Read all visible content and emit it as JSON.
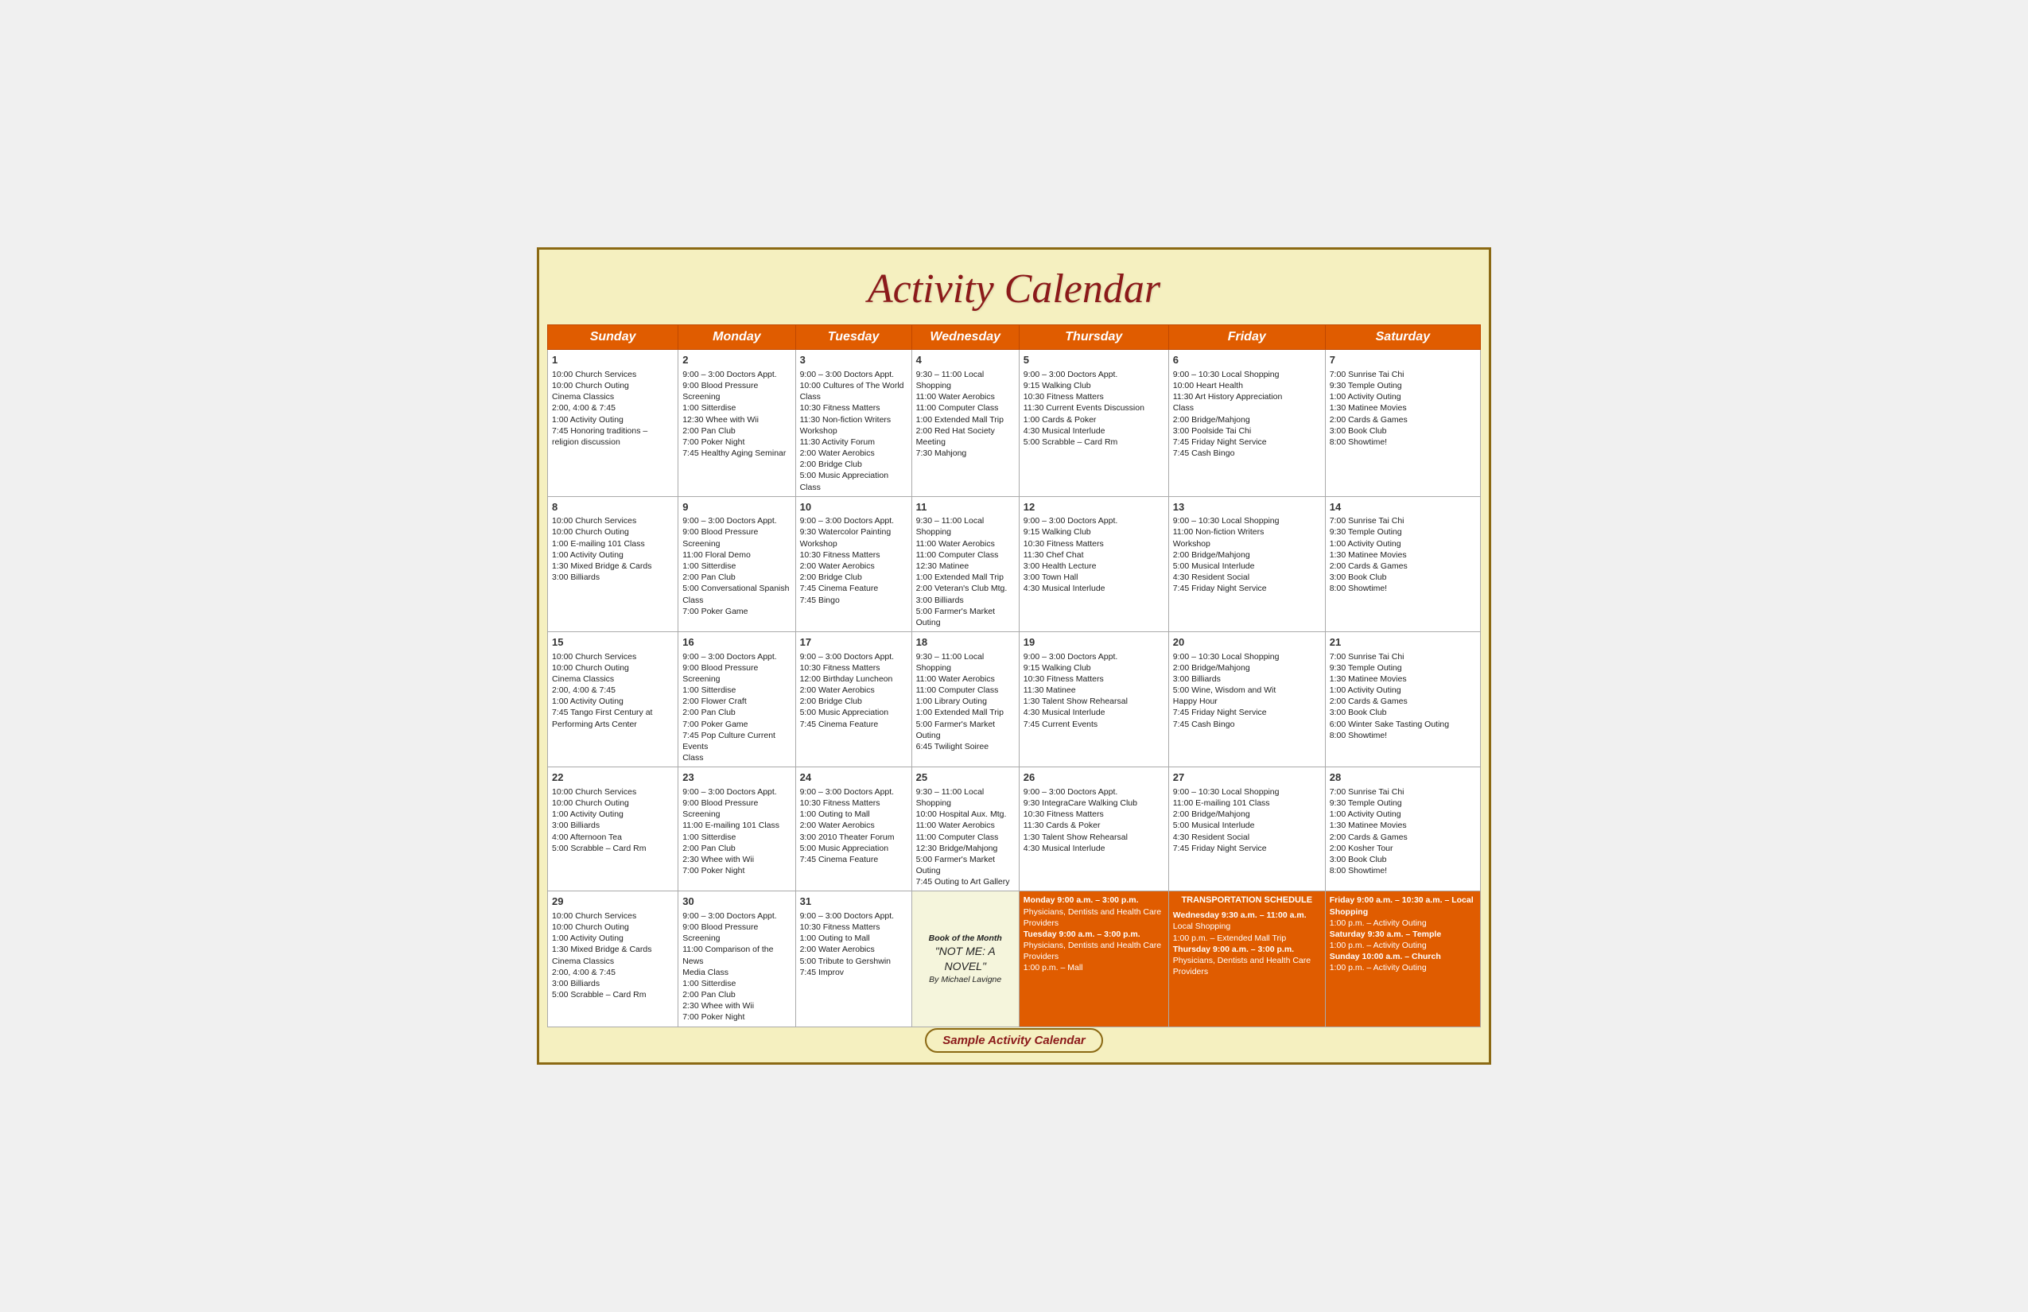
{
  "title": "Activity Calendar",
  "footer": "Sample Activity Calendar",
  "days": [
    "Sunday",
    "Monday",
    "Tuesday",
    "Wednesday",
    "Thursday",
    "Friday",
    "Saturday"
  ],
  "weeks": [
    {
      "cells": [
        {
          "day": 1,
          "events": [
            "10:00 Church Services",
            "10:00 Church Outing",
            "Cinema Classics",
            "2:00, 4:00 & 7:45",
            "1:00 Activity Outing",
            "7:45 Honoring traditions –",
            "religion discussion"
          ]
        },
        {
          "day": 2,
          "events": [
            "9:00 – 3:00 Doctors Appt.",
            "9:00 Blood Pressure Screening",
            "1:00 Sitterdise",
            "12:30 Whee with Wii",
            "2:00 Pan Club",
            "7:00 Poker Night",
            "7:45 Healthy Aging Seminar"
          ]
        },
        {
          "day": 3,
          "events": [
            "9:00 – 3:00 Doctors Appt.",
            "10:00 Cultures of The World Class",
            "10:30 Fitness Matters",
            "11:30 Non-fiction Writers Workshop",
            "11:30 Activity Forum",
            "2:00 Water Aerobics",
            "2:00 Bridge Club",
            "5:00 Music Appreciation Class"
          ]
        },
        {
          "day": 4,
          "events": [
            "9:30 – 11:00 Local Shopping",
            "11:00 Water Aerobics",
            "11:00 Computer Class",
            "1:00 Extended Mall Trip",
            "2:00 Red Hat Society Meeting",
            "7:30 Mahjong"
          ]
        },
        {
          "day": 5,
          "events": [
            "9:00 – 3:00 Doctors Appt.",
            "9:15 Walking Club",
            "10:30 Fitness Matters",
            "11:30 Current Events Discussion",
            "1:00 Cards & Poker",
            "4:30 Musical Interlude",
            "5:00 Scrabble – Card Rm"
          ]
        },
        {
          "day": 6,
          "events": [
            "9:00 – 10:30 Local Shopping",
            "10:00 Heart Health",
            "11:30 Art History Appreciation",
            "Class",
            "2:00 Bridge/Mahjong",
            "3:00 Poolside Tai Chi",
            "7:45 Friday Night Service",
            "7:45 Cash Bingo"
          ]
        },
        {
          "day": 7,
          "events": [
            "7:00 Sunrise Tai Chi",
            "9:30 Temple Outing",
            "1:00 Activity Outing",
            "1:30 Matinee Movies",
            "2:00 Cards & Games",
            "3:00 Book Club",
            "8:00 Showtime!"
          ]
        }
      ]
    },
    {
      "cells": [
        {
          "day": 8,
          "events": [
            "10:00 Church Services",
            "10:00 Church Outing",
            "1:00 E-mailing 101 Class",
            "1:00 Activity Outing",
            "1:30 Mixed Bridge & Cards",
            "3:00 Billiards"
          ]
        },
        {
          "day": 9,
          "events": [
            "9:00 – 3:00 Doctors Appt.",
            "9:00 Blood Pressure Screening",
            "11:00 Floral Demo",
            "1:00 Sitterdise",
            "2:00 Pan Club",
            "5:00 Conversational Spanish Class",
            "7:00 Poker Game"
          ]
        },
        {
          "day": 10,
          "events": [
            "9:00 – 3:00 Doctors Appt.",
            "9:30 Watercolor Painting",
            "Workshop",
            "10:30 Fitness Matters",
            "2:00 Water Aerobics",
            "2:00 Bridge Club",
            "7:45 Cinema Feature",
            "7:45 Bingo"
          ]
        },
        {
          "day": 11,
          "events": [
            "9:30 – 11:00 Local Shopping",
            "11:00 Water Aerobics",
            "11:00 Computer Class",
            "12:30 Matinee",
            "1:00 Extended Mall Trip",
            "2:00 Veteran's Club Mtg.",
            "3:00 Billiards",
            "5:00 Farmer's Market Outing"
          ]
        },
        {
          "day": 12,
          "events": [
            "9:00 – 3:00 Doctors Appt.",
            "9:15 Walking Club",
            "10:30 Fitness Matters",
            "11:30 Chef Chat",
            "3:00 Health Lecture",
            "3:00 Town Hall",
            "4:30 Musical Interlude"
          ]
        },
        {
          "day": 13,
          "events": [
            "9:00 – 10:30 Local Shopping",
            "11:00 Non-fiction Writers",
            "Workshop",
            "2:00 Bridge/Mahjong",
            "5:00 Musical Interlude",
            "4:30 Resident Social",
            "7:45 Friday Night Service"
          ]
        },
        {
          "day": 14,
          "events": [
            "7:00 Sunrise Tai Chi",
            "9:30 Temple Outing",
            "1:00 Activity Outing",
            "1:30 Matinee Movies",
            "2:00 Cards & Games",
            "3:00 Book Club",
            "8:00 Showtime!"
          ]
        }
      ]
    },
    {
      "cells": [
        {
          "day": 15,
          "events": [
            "10:00 Church Services",
            "10:00 Church Outing",
            "Cinema Classics",
            "2:00, 4:00 & 7:45",
            "1:00 Activity Outing",
            "7:45 Tango First Century at",
            "Performing Arts Center"
          ]
        },
        {
          "day": 16,
          "events": [
            "9:00 – 3:00 Doctors Appt.",
            "9:00 Blood Pressure Screening",
            "1:00 Sitterdise",
            "2:00 Flower Craft",
            "2:00 Pan Club",
            "7:00 Poker Game",
            "7:45 Pop Culture Current Events",
            "Class"
          ]
        },
        {
          "day": 17,
          "events": [
            "9:00 – 3:00 Doctors Appt.",
            "10:30 Fitness Matters",
            "12:00 Birthday Luncheon",
            "2:00 Water Aerobics",
            "2:00 Bridge Club",
            "5:00 Music Appreciation",
            "7:45 Cinema Feature"
          ]
        },
        {
          "day": 18,
          "events": [
            "9:30 – 11:00 Local Shopping",
            "11:00 Water Aerobics",
            "11:00 Computer Class",
            "1:00 Library Outing",
            "1:00 Extended Mall Trip",
            "5:00 Farmer's Market Outing",
            "6:45 Twilight Soiree"
          ]
        },
        {
          "day": 19,
          "events": [
            "9:00 – 3:00 Doctors Appt.",
            "9:15 Walking Club",
            "10:30 Fitness Matters",
            "11:30 Matinee",
            "1:30 Talent Show Rehearsal",
            "4:30 Musical Interlude",
            "7:45 Current Events"
          ]
        },
        {
          "day": 20,
          "events": [
            "9:00 – 10:30 Local Shopping",
            "2:00 Bridge/Mahjong",
            "3:00 Billiards",
            "5:00 Wine, Wisdom and Wit",
            "Happy Hour",
            "7:45 Friday Night Service",
            "7:45 Cash Bingo"
          ]
        },
        {
          "day": 21,
          "events": [
            "7:00 Sunrise Tai Chi",
            "9:30 Temple Outing",
            "1:30 Matinee Movies",
            "1:00 Activity Outing",
            "2:00 Cards & Games",
            "3:00 Book Club",
            "6:00 Winter Sake Tasting Outing",
            "8:00 Showtime!"
          ]
        }
      ]
    },
    {
      "cells": [
        {
          "day": 22,
          "events": [
            "10:00 Church Services",
            "10:00 Church Outing",
            "1:00 Activity Outing",
            "3:00 Billiards",
            "4:00 Afternoon Tea",
            "5:00 Scrabble – Card Rm"
          ]
        },
        {
          "day": 23,
          "events": [
            "9:00 – 3:00 Doctors Appt.",
            "9:00 Blood Pressure Screening",
            "11:00 E-mailing 101 Class",
            "1:00 Sitterdise",
            "2:00 Pan Club",
            "2:30 Whee with Wii",
            "7:00 Poker Night"
          ]
        },
        {
          "day": 24,
          "events": [
            "9:00 – 3:00 Doctors Appt.",
            "10:30 Fitness Matters",
            "1:00 Outing to Mall",
            "2:00 Water Aerobics",
            "3:00 2010 Theater Forum",
            "5:00 Music Appreciation",
            "7:45 Cinema Feature"
          ]
        },
        {
          "day": 25,
          "events": [
            "9:30 – 11:00 Local Shopping",
            "10:00 Hospital Aux. Mtg.",
            "11:00 Water Aerobics",
            "11:00 Computer Class",
            "12:30 Bridge/Mahjong",
            "5:00 Farmer's Market Outing",
            "7:45 Outing to Art Gallery"
          ]
        },
        {
          "day": 26,
          "events": [
            "9:00 – 3:00 Doctors Appt.",
            "9:30 IntegraCare Walking Club",
            "10:30 Fitness Matters",
            "11:30 Cards & Poker",
            "1:30 Talent Show Rehearsal",
            "4:30 Musical Interlude"
          ]
        },
        {
          "day": 27,
          "events": [
            "9:00 – 10:30 Local Shopping",
            "11:00 E-mailing 101 Class",
            "2:00 Bridge/Mahjong",
            "5:00 Musical Interlude",
            "4:30 Resident Social",
            "7:45 Friday Night Service"
          ]
        },
        {
          "day": 28,
          "events": [
            "7:00 Sunrise Tai Chi",
            "9:30 Temple Outing",
            "1:00 Activity Outing",
            "1:30 Matinee Movies",
            "2:00 Cards & Games",
            "2:00 Kosher Tour",
            "3:00 Book Club",
            "8:00 Showtime!"
          ]
        }
      ]
    },
    {
      "cells": [
        {
          "day": 29,
          "events": [
            "10:00 Church Services",
            "10:00 Church Outing",
            "1:00 Activity Outing",
            "1:30 Mixed Bridge & Cards",
            "Cinema Classics",
            "2:00, 4:00 & 7:45",
            "3:00 Billiards",
            "5:00 Scrabble – Card Rm"
          ]
        },
        {
          "day": 30,
          "events": [
            "9:00 – 3:00 Doctors Appt.",
            "9:00 Blood Pressure Screening",
            "11:00 Comparison of the News",
            "Media Class",
            "1:00 Sitterdise",
            "2:00 Pan Club",
            "2:30 Whee with Wii",
            "7:00 Poker Night"
          ]
        },
        {
          "day": 31,
          "events": [
            "9:00 – 3:00 Doctors Appt.",
            "10:30 Fitness Matters",
            "1:00 Outing to Mall",
            "2:00 Water Aerobics",
            "5:00 Tribute to Gershwin",
            "7:45 Improv"
          ]
        },
        {
          "day": null,
          "isBook": true,
          "bookText": "Book of the Month\n\"NOT ME: A NOVEL\"\nBy Michael Lavigne"
        },
        {
          "day": null,
          "isOrange": true,
          "transportTitle": "",
          "transportText": "Monday 9:00 a.m. – 3:00 p.m.\nPhysicians, Dentists and Health Care Providers\nTuesday 9:00 a.m. – 3:00 p.m.\nPhysicians, Dentists and Health Care Providers\n1:00 p.m. – Mall"
        },
        {
          "day": null,
          "isOrange": true,
          "transportTitle": "TRANSPORTATION SCHEDULE",
          "transportText": "Wednesday 9:30 a.m. – 11:00 a.m.\nLocal Shopping\n1:00 p.m. – Extended Mall Trip\nThursday 9:00 a.m. – 3:00 p.m.\nPhysicians, Dentists and Health Care Providers"
        },
        {
          "day": null,
          "isOrange": true,
          "transportTitle": "",
          "transportText": "Friday 9:00 a.m. – 10:30 a.m. – Local Shopping\n1:00 p.m. – Activity Outing\nSaturday 9:30 a.m. – Temple\n1:00 p.m. – Activity Outing\nSunday 10:00 a.m. – Church\n1:00 p.m. – Activity Outing"
        }
      ]
    }
  ]
}
